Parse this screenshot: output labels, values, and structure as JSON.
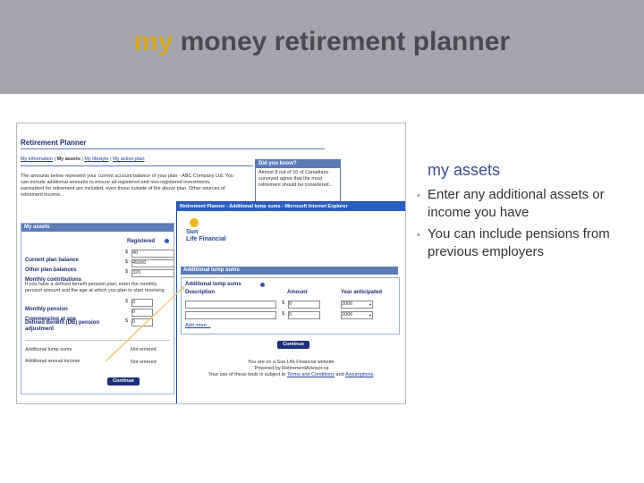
{
  "slide": {
    "title_accent": "my",
    "title_rest": " money retirement planner",
    "assets_heading": "my assets",
    "bullets": [
      "Enter any additional assets or income you have",
      "You can include pensions from previous employers"
    ]
  },
  "planner": {
    "title": "Retirement Planner",
    "tabs": [
      "My information",
      "My assets",
      "My lifestyle",
      "My action plan"
    ],
    "intro": "The amounts below represent your current account balance of your plan - ABC Company Ltd. You can include additional amounts to ensure all registered and non-registered investments earmarked for retirement are included, even those outside of the above plan. Other sources of retirement income...",
    "section_title": "My assets",
    "col_registered": "Registered",
    "rows": [
      {
        "label": "Current plan balance",
        "prefix": "$",
        "value": "40"
      },
      {
        "label": "Other plan balances",
        "prefix": "$",
        "value": "45000"
      },
      {
        "label": "Monthly contributions",
        "prefix": "$",
        "value": "320"
      }
    ],
    "db_note": "If you have a defined benefit pension plan, enter the monthly pension amount and the age at which you plan to start receiving the pension.",
    "pension_rows": [
      {
        "label": "Monthly pension",
        "prefix": "$",
        "value": "0"
      },
      {
        "label": "Commencing at age",
        "prefix": "",
        "value": "0"
      },
      {
        "label": "Defined Benefit (DB) pension adjustment",
        "prefix": "$",
        "value": "0"
      }
    ],
    "links": [
      {
        "label": "Additional lump sums",
        "status": "Not entered"
      },
      {
        "label": "Additional annual income",
        "status": "Not entered"
      }
    ],
    "continue": "Continue",
    "did_you_know": "Did you know?",
    "dyk_text": "Almost 8 out of 10 of Canadians surveyed agree that the most retirement should be considered..."
  },
  "popup": {
    "window_title": "Retirement Planner - Additional lump sums - Microsoft Internet Explorer",
    "logo_top": "Sun",
    "logo_bottom": "Life Financial",
    "section": "Additional lump sums",
    "subsection": "Additional lump sums",
    "col_desc": "Description",
    "col_amount": "Amount",
    "col_year": "Year anticipated",
    "rows": [
      {
        "prefix": "$",
        "amount": "0",
        "year": "2006"
      },
      {
        "prefix": "$",
        "amount": "0",
        "year": "2006"
      }
    ],
    "add_more": "Add more...",
    "continue": "Continue",
    "footer_1": "You are on a Sun Life Financial website.",
    "footer_2": "Powered by RetirementAdvisor.ca",
    "footer_3_pre": "Your use of these tools is subject to",
    "footer_terms": "Terms and Conditions",
    "footer_and": "and",
    "footer_assumptions": "Assumptions"
  }
}
